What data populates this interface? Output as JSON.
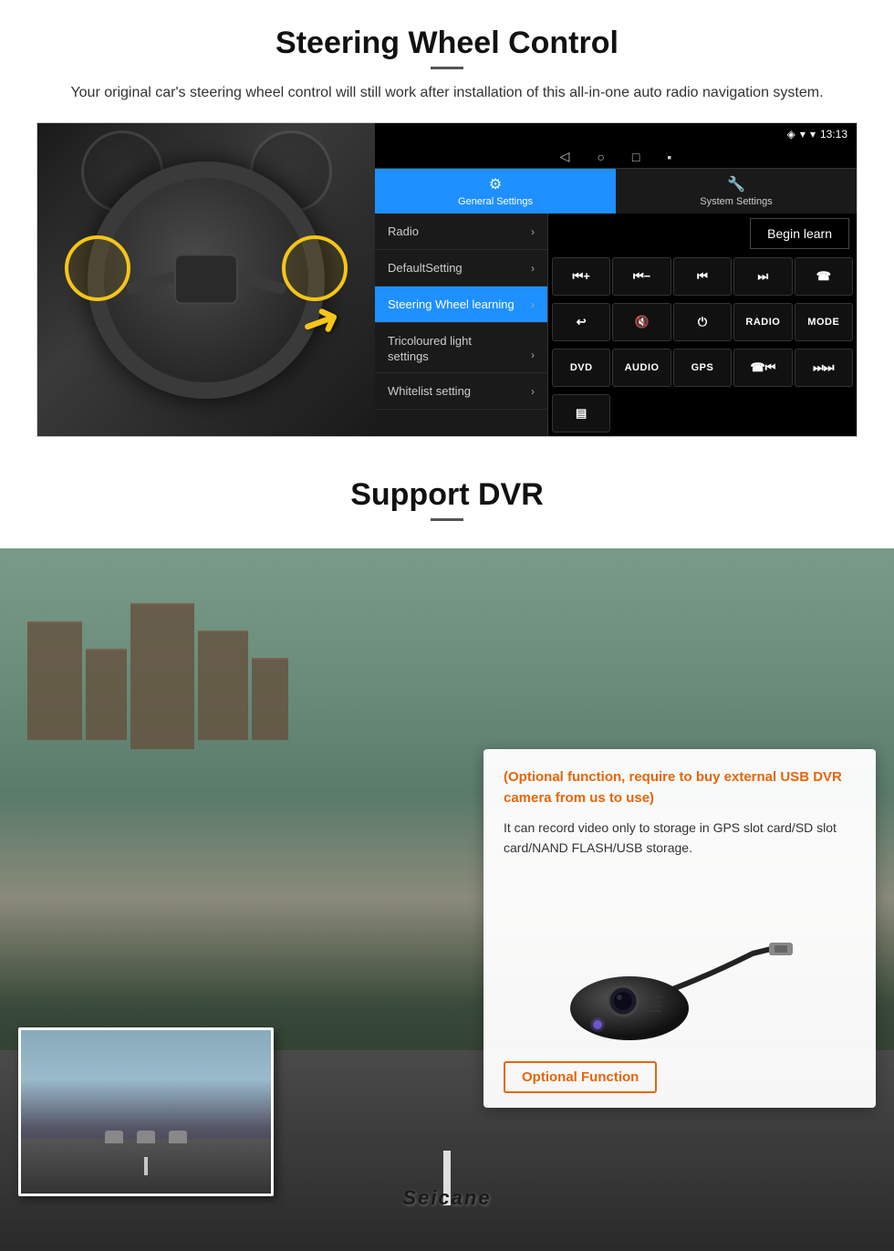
{
  "steering": {
    "title": "Steering Wheel Control",
    "subtitle": "Your original car's steering wheel control will still work after installation of this all-in-one auto radio navigation system.",
    "statusbar": {
      "time": "13:13",
      "signal": "▾",
      "wifi": "▾"
    },
    "tabs": [
      {
        "id": "general",
        "icon": "⚙",
        "label": "General Settings",
        "active": true
      },
      {
        "id": "system",
        "icon": "🔧",
        "label": "System Settings",
        "active": false
      }
    ],
    "menu": [
      {
        "label": "Radio",
        "active": false
      },
      {
        "label": "DefaultSetting",
        "active": false
      },
      {
        "label": "Steering Wheel learning",
        "active": true
      },
      {
        "label": "Tricoloured light\nsettings",
        "active": false
      },
      {
        "label": "Whitelist setting",
        "active": false
      }
    ],
    "begin_learn_label": "Begin learn",
    "control_buttons": [
      [
        "⏮+",
        "⏮−",
        "⏮⏮",
        "⏭⏭",
        "☎"
      ],
      [
        "↩",
        "🔇",
        "⏻",
        "RADIO",
        "MODE"
      ],
      [
        "DVD",
        "AUDIO",
        "GPS",
        "☎⏮",
        "⏭⏭"
      ]
    ]
  },
  "dvr": {
    "title": "Support DVR",
    "optional_text": "(Optional function, require to buy external USB DVR camera from us to use)",
    "desc_text": "It can record video only to storage in GPS slot card/SD slot card/NAND FLASH/USB storage.",
    "optional_badge_label": "Optional Function",
    "logo": "Seicane"
  }
}
